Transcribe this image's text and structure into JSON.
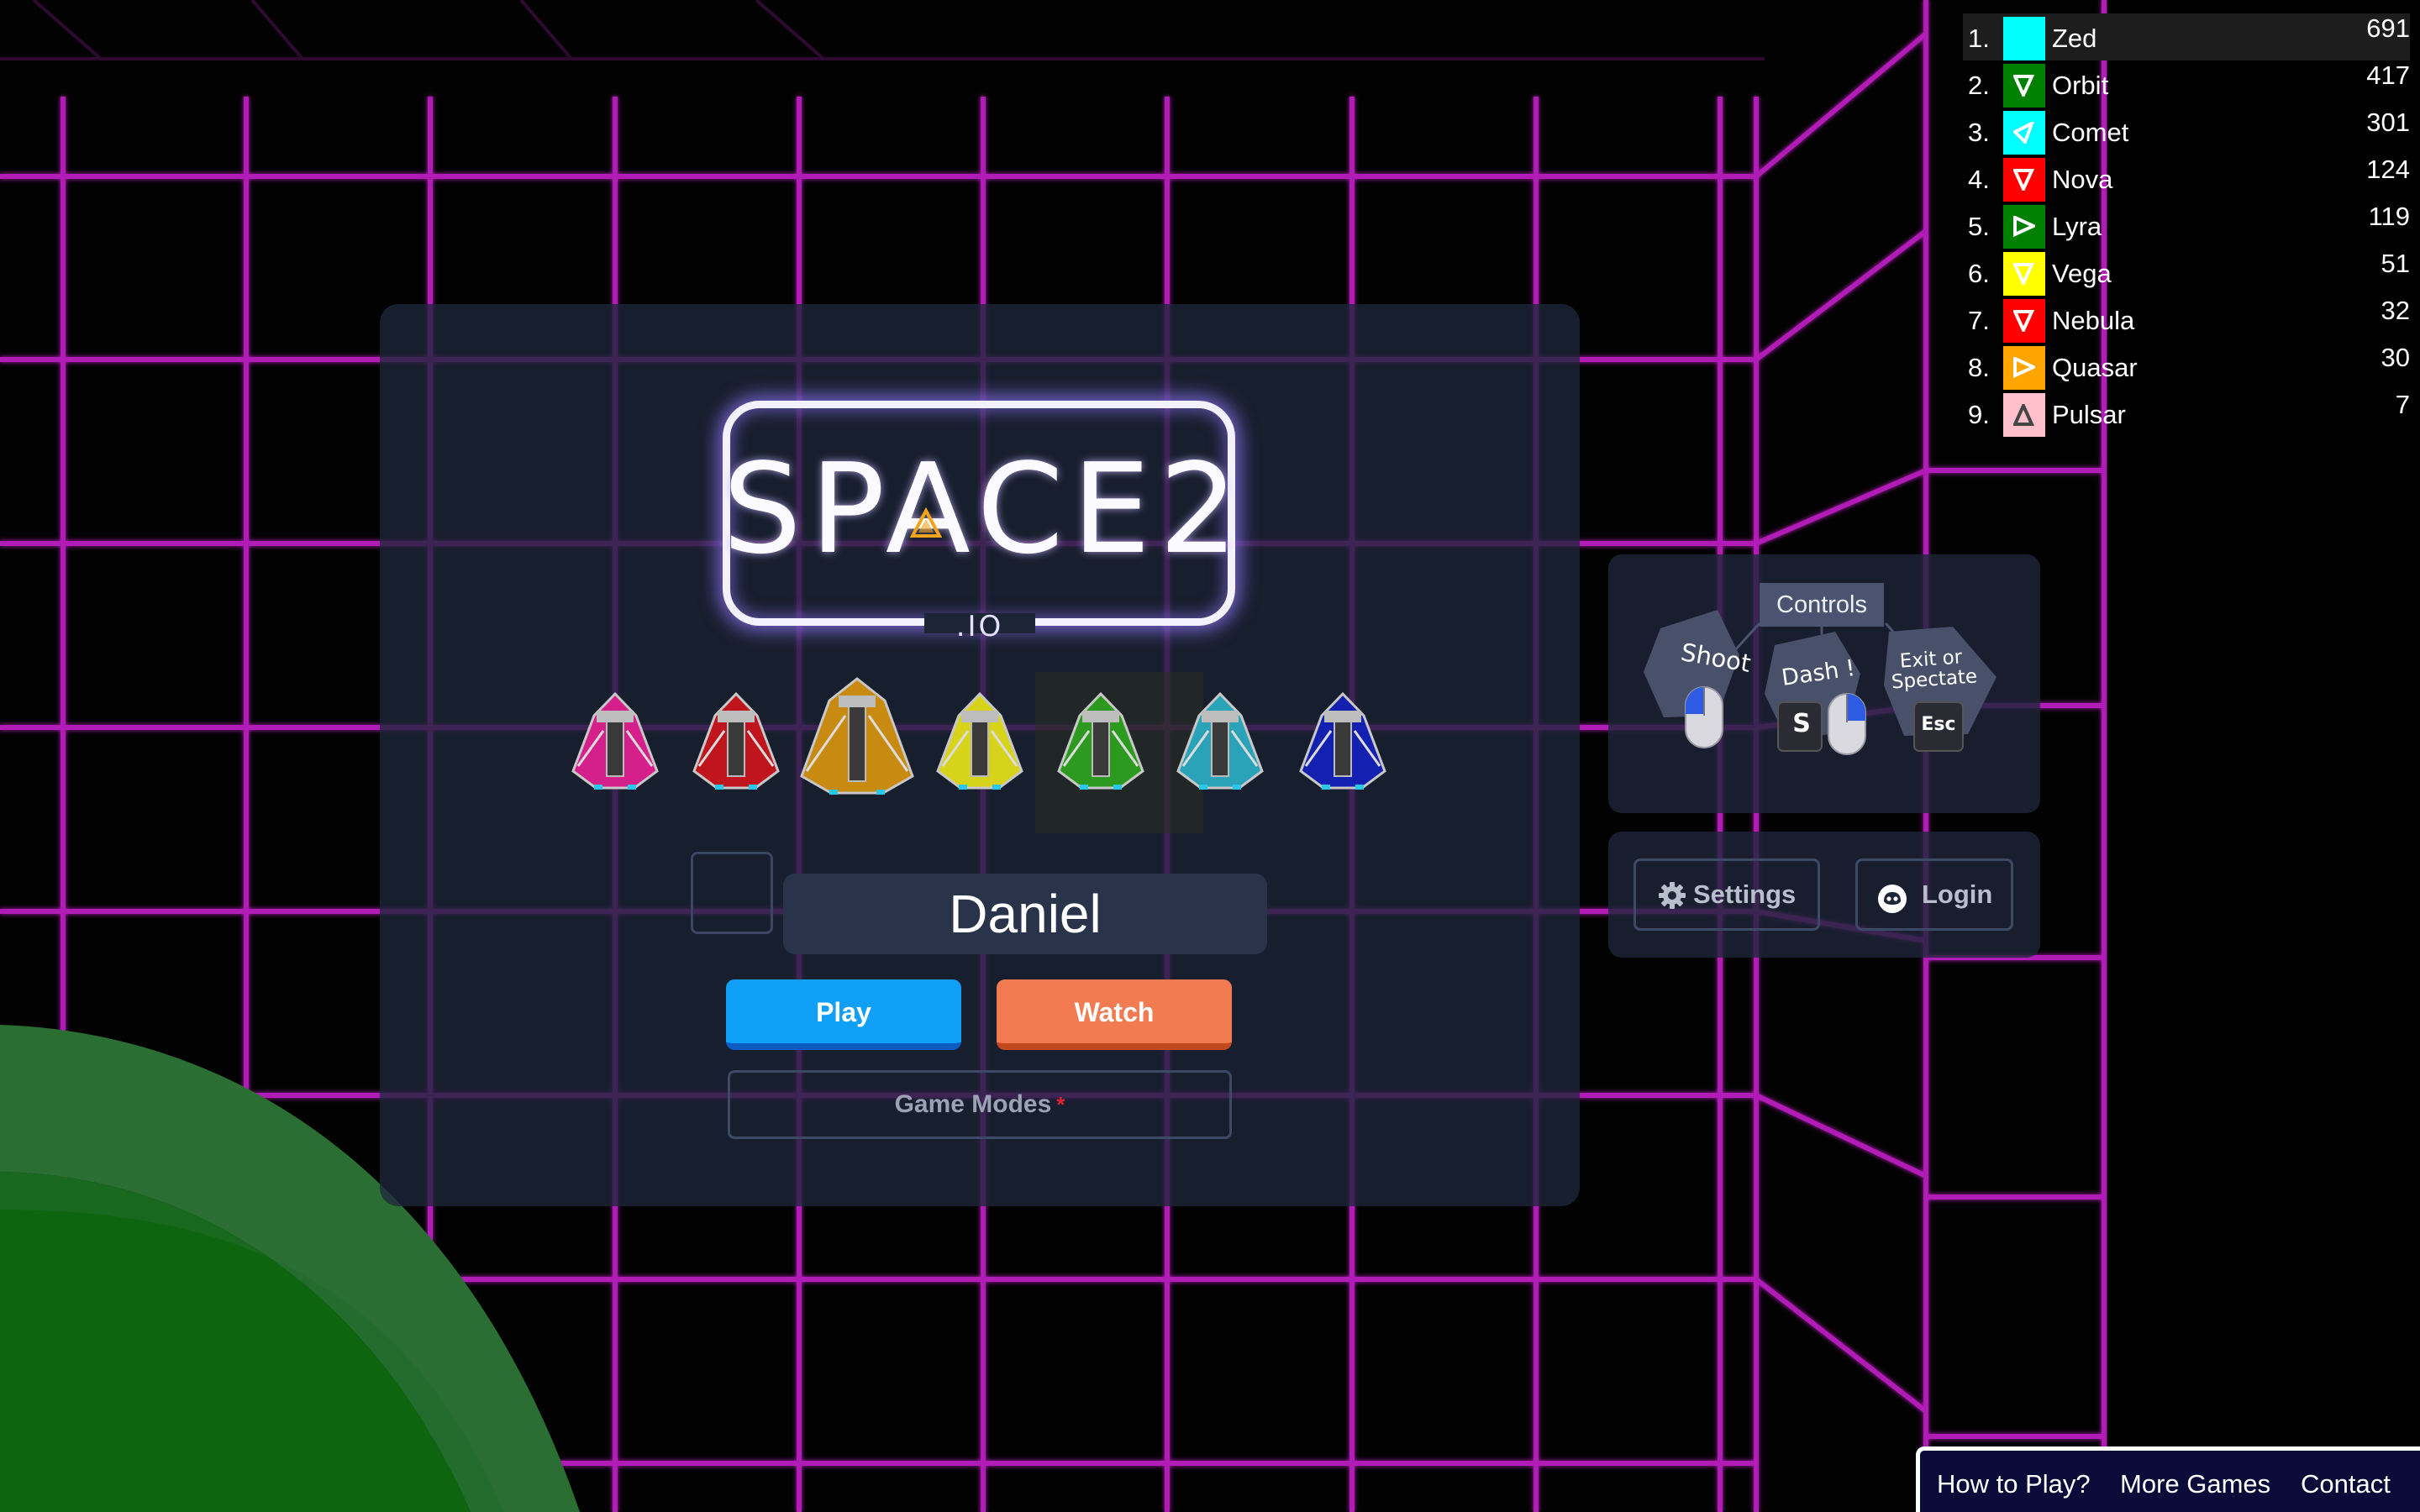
{
  "colors": {
    "grid": "#b01ab5",
    "panel": "#1e263a",
    "play": "#10a0f7",
    "watch": "#f27b52",
    "tube_dark": "#2b6e34",
    "tube_light": "#0d660f"
  },
  "logo": {
    "title": "SPACE2",
    "subtitle": ".IO"
  },
  "ships": [
    {
      "name": "magenta-ship",
      "color": "#d51f8a"
    },
    {
      "name": "red-ship",
      "color": "#c0151c"
    },
    {
      "name": "orange-ship",
      "color": "#c98a12"
    },
    {
      "name": "yellow-ship",
      "color": "#d7d31b"
    },
    {
      "name": "green-ship",
      "color": "#2c9a1e"
    },
    {
      "name": "cyan-ship",
      "color": "#2aa3b8"
    },
    {
      "name": "blue-ship",
      "color": "#1420b0"
    }
  ],
  "player": {
    "name": "Daniel"
  },
  "buttons": {
    "play": "Play",
    "watch": "Watch",
    "game_modes": "Game Modes",
    "required_mark": "*"
  },
  "controls": {
    "title": "Controls",
    "shoot": "Shoot",
    "dash": "Dash !",
    "dash_key": "S",
    "exit_line1": "Exit or",
    "exit_line2": "Spectate",
    "exit_key": "Esc"
  },
  "side_buttons": {
    "settings": "Settings",
    "login": "Login"
  },
  "leaderboard": [
    {
      "rank": "1.",
      "name": "Zed",
      "score": "691",
      "color": "#00ffff",
      "icon": "none",
      "icon_color": "#ffffff"
    },
    {
      "rank": "2.",
      "name": "Orbit",
      "score": "417",
      "color": "#008000",
      "icon": "down",
      "icon_color": "#ffffff"
    },
    {
      "rank": "3.",
      "name": "Comet",
      "score": "301",
      "color": "#00ffff",
      "icon": "upright",
      "icon_color": "#ffffff"
    },
    {
      "rank": "4.",
      "name": "Nova",
      "score": "124",
      "color": "#ff0000",
      "icon": "down",
      "icon_color": "#ffffff"
    },
    {
      "rank": "5.",
      "name": "Lyra",
      "score": "119",
      "color": "#008000",
      "icon": "right",
      "icon_color": "#ffffff"
    },
    {
      "rank": "6.",
      "name": "Vega",
      "score": "51",
      "color": "#ffff00",
      "icon": "down",
      "icon_color": "#ffffff"
    },
    {
      "rank": "7.",
      "name": "Nebula",
      "score": "32",
      "color": "#ff0000",
      "icon": "down",
      "icon_color": "#ffffff"
    },
    {
      "rank": "8.",
      "name": "Quasar",
      "score": "30",
      "color": "#ffa500",
      "icon": "right",
      "icon_color": "#ffffff"
    },
    {
      "rank": "9.",
      "name": "Pulsar",
      "score": "7",
      "color": "#ffc0cb",
      "icon": "up",
      "icon_color": "#ffffff"
    }
  ],
  "footer": {
    "how_to_play": "How to Play?",
    "more_games": "More Games",
    "contact": "Contact"
  }
}
